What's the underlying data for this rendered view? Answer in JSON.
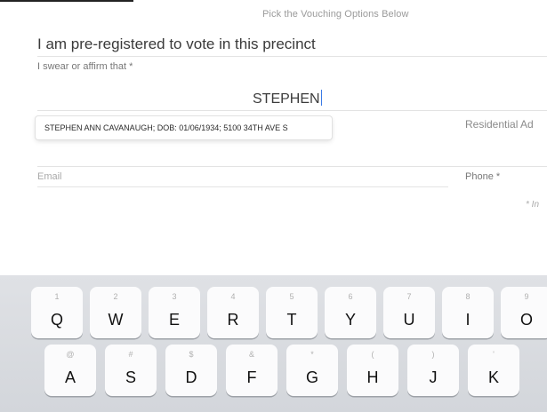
{
  "header": {
    "hint": "Pick the Vouching Options Below"
  },
  "form": {
    "prereg_label": "I am pre-registered to vote in this precinct",
    "swear_label": "I swear or affirm that *",
    "name_value": "STEPHEN",
    "suggestion": "STEPHEN ANN CAVANAUGH; DOB: 01/06/1934; 5100 34TH AVE S",
    "residential_label": "Residential Ad",
    "email_placeholder": "Email",
    "phone_label": "Phone *",
    "required_note": "* In"
  },
  "keyboard": {
    "row1": [
      {
        "char": "Q",
        "num": "1"
      },
      {
        "char": "W",
        "num": "2"
      },
      {
        "char": "E",
        "num": "3"
      },
      {
        "char": "R",
        "num": "4"
      },
      {
        "char": "T",
        "num": "5"
      },
      {
        "char": "Y",
        "num": "6"
      },
      {
        "char": "U",
        "num": "7"
      },
      {
        "char": "I",
        "num": "8"
      },
      {
        "char": "O",
        "num": "9"
      }
    ],
    "row2": [
      {
        "char": "A",
        "num": "@"
      },
      {
        "char": "S",
        "num": "#"
      },
      {
        "char": "D",
        "num": "$"
      },
      {
        "char": "F",
        "num": "&"
      },
      {
        "char": "G",
        "num": "*"
      },
      {
        "char": "H",
        "num": "("
      },
      {
        "char": "J",
        "num": ")"
      },
      {
        "char": "K",
        "num": "'"
      }
    ]
  }
}
